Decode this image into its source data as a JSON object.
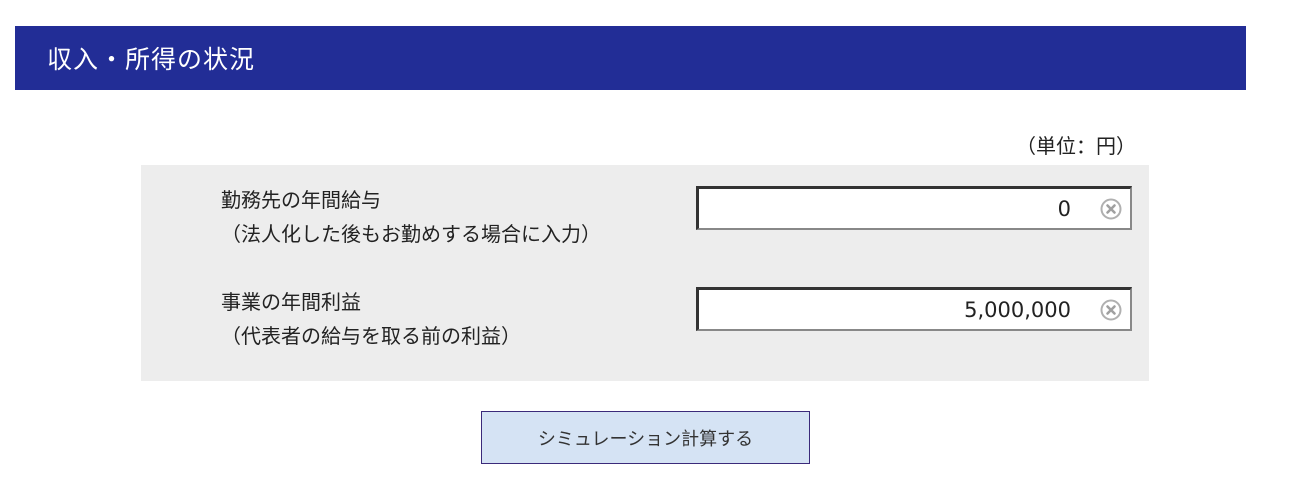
{
  "header": {
    "title": "収入・所得の状況"
  },
  "unit_note": "（単位：円）",
  "rows": [
    {
      "label": "勤務先の年間給与",
      "sublabel": "（法人化した後もお勤めする場合に入力）",
      "value": "0",
      "clear_icon": "clear-circle-x-icon"
    },
    {
      "label": "事業の年間利益",
      "sublabel": "（代表者の給与を取る前の利益）",
      "value": "5,000,000",
      "clear_icon": "clear-circle-x-icon"
    }
  ],
  "button": {
    "label": "シミュレーション計算する"
  },
  "colors": {
    "header_bg": "#222d96",
    "panel_bg": "#ededed",
    "button_bg": "#d5e3f4",
    "button_border": "#3b2a7a"
  }
}
